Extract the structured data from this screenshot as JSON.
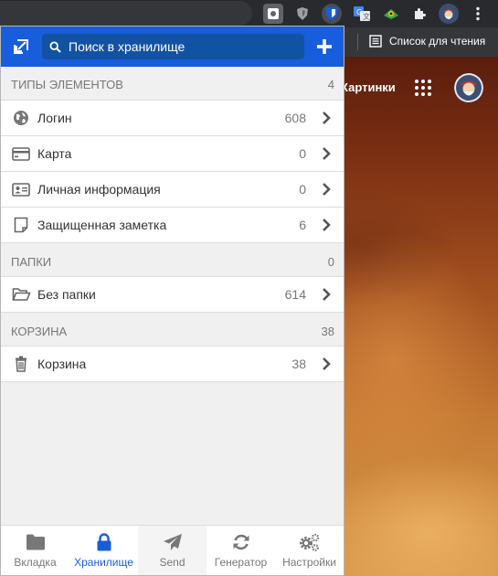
{
  "browser": {
    "reading_list_label": "Список для чтения"
  },
  "page": {
    "images_link": "Картинки"
  },
  "header": {
    "search_placeholder": "Поиск в хранилище"
  },
  "sections": {
    "types": {
      "title": "ТИПЫ ЭЛЕМЕНТОВ",
      "count": "4",
      "items": [
        {
          "label": "Логин",
          "count": "608",
          "icon": "globe-icon"
        },
        {
          "label": "Карта",
          "count": "0",
          "icon": "credit-card-icon"
        },
        {
          "label": "Личная информация",
          "count": "0",
          "icon": "id-card-icon"
        },
        {
          "label": "Защищенная заметка",
          "count": "6",
          "icon": "note-icon"
        }
      ]
    },
    "folders": {
      "title": "ПАПКИ",
      "count": "0",
      "items": [
        {
          "label": "Без папки",
          "count": "614",
          "icon": "folder-open-icon"
        }
      ]
    },
    "trash": {
      "title": "КОРЗИНА",
      "count": "38",
      "items": [
        {
          "label": "Корзина",
          "count": "38",
          "icon": "trash-icon"
        }
      ]
    }
  },
  "footer": {
    "tabs": [
      {
        "label": "Вкладка",
        "icon": "folder-icon"
      },
      {
        "label": "Хранилище",
        "icon": "lock-icon"
      },
      {
        "label": "Send",
        "icon": "paper-plane-icon"
      },
      {
        "label": "Генератор",
        "icon": "refresh-icon"
      },
      {
        "label": "Настройки",
        "icon": "gears-icon"
      }
    ]
  },
  "colors": {
    "brand": "#175ddc",
    "header_search_bg": "#1252a3",
    "muted_text": "#777777",
    "body_bg": "#f0f0f0"
  }
}
